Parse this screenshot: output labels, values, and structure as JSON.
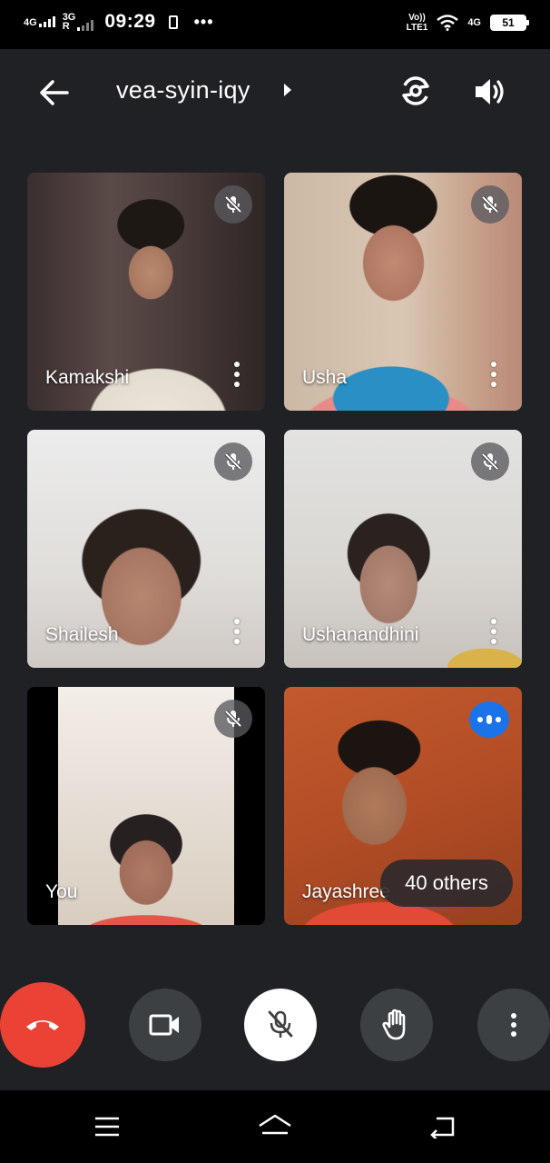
{
  "status_bar": {
    "sim1_network": "4G",
    "sim2_network": "3G",
    "sim2_sub": "R",
    "time": "09:29",
    "overflow": "•••",
    "volte_top": "Vo))",
    "volte_bottom": "LTE1",
    "data_network": "4G",
    "battery": "51"
  },
  "meeting": {
    "code": "vea-syin-iqy"
  },
  "icons": {
    "back": "arrow-left-icon",
    "switch_camera": "camera-switch-icon",
    "speaker": "speaker-icon",
    "muted": "mic-off-icon",
    "speaking": "speaking-dots-icon",
    "end_call": "phone-hangup-icon",
    "camera": "video-camera-icon",
    "mic": "mic-off-icon",
    "raise_hand": "hand-icon",
    "more": "more-vertical-icon"
  },
  "participants": [
    {
      "name": "Kamakshi",
      "muted": true
    },
    {
      "name": "Usha",
      "muted": true
    },
    {
      "name": "Shailesh",
      "muted": true
    },
    {
      "name": "Ushanandhini",
      "muted": true
    },
    {
      "name": "You",
      "muted": true
    },
    {
      "name": "Jayashree",
      "muted": false,
      "speaking": true
    }
  ],
  "others_label": "40 others",
  "colors": {
    "end_call": "#ea4335",
    "speaking_badge": "#1a73e8",
    "app_background": "#202124",
    "control_button": "#3c4043"
  }
}
